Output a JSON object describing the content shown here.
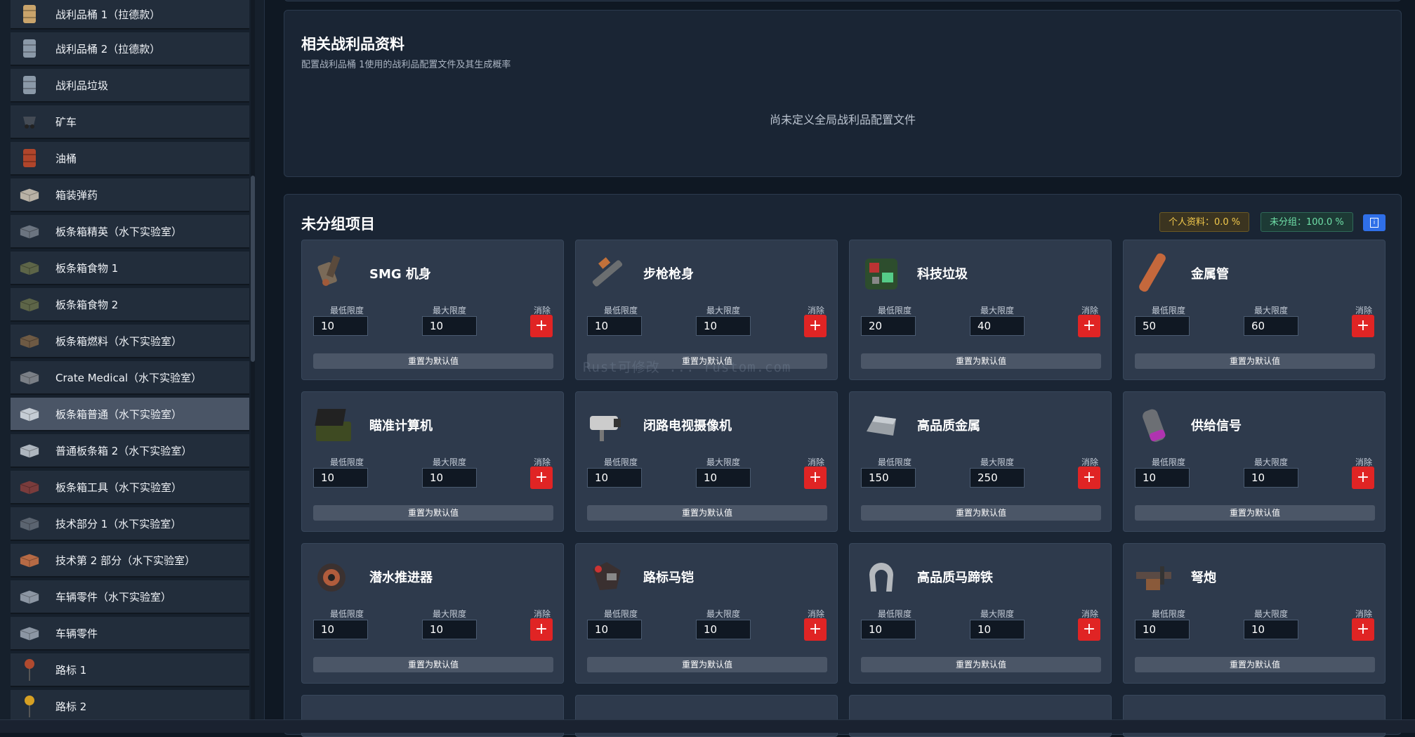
{
  "sidebar": {
    "items": [
      {
        "label": "战利品桶 1（拉德款）",
        "icon": "barrel-icon",
        "color": "#c9a46b"
      },
      {
        "label": "战利品桶 2（拉德款）",
        "icon": "barrel-icon",
        "color": "#8b99a8"
      },
      {
        "label": "战利品垃圾",
        "icon": "trash-barrel-icon",
        "color": "#8b99a8"
      },
      {
        "label": "矿车",
        "icon": "minecart-icon",
        "color": "#444b55"
      },
      {
        "label": "油桶",
        "icon": "oil-barrel-icon",
        "color": "#b0452b"
      },
      {
        "label": "箱装弹药",
        "icon": "ammo-crate-icon",
        "color": "#b9b2a6"
      },
      {
        "label": "板条箱精英（水下实验室）",
        "icon": "crate-icon",
        "color": "#6b7480"
      },
      {
        "label": "板条箱食物 1",
        "icon": "food-crate-icon",
        "color": "#5d6548"
      },
      {
        "label": "板条箱食物 2",
        "icon": "food-crate-icon",
        "color": "#5d6548"
      },
      {
        "label": "板条箱燃料（水下实验室）",
        "icon": "fuel-crate-icon",
        "color": "#6e5a44"
      },
      {
        "label": "Crate Medical（水下实验室）",
        "icon": "medical-crate-icon",
        "color": "#7a7f86"
      },
      {
        "label": "板条箱普通（水下实验室）",
        "icon": "crate-icon",
        "color": "#c5ccd4",
        "active": true
      },
      {
        "label": "普通板条箱 2（水下实验室）",
        "icon": "crate-icon",
        "color": "#aeb6bf"
      },
      {
        "label": "板条箱工具（水下实验室）",
        "icon": "tool-crate-icon",
        "color": "#7a3c3c"
      },
      {
        "label": "技术部分 1（水下实验室）",
        "icon": "tech-crate-icon",
        "color": "#5b6470"
      },
      {
        "label": "技术第 2 部分（水下实验室）",
        "icon": "tech-crate-icon",
        "color": "#b66a45"
      },
      {
        "label": "车辆零件（水下实验室）",
        "icon": "vehicle-parts-icon",
        "color": "#8c96a3"
      },
      {
        "label": "车辆零件",
        "icon": "vehicle-parts-icon",
        "color": "#8c96a3"
      },
      {
        "label": "路标 1",
        "icon": "roadsign-icon",
        "color": "#b04a2f"
      },
      {
        "label": "路标 2",
        "icon": "roadsign-icon",
        "color": "#d6a023"
      }
    ]
  },
  "loot_panel": {
    "title": "相关战利品资料",
    "subtitle": "配置战利品桶 1使用的战利品配置文件及其生成概率",
    "empty_message": "尚未定义全局战利品配置文件"
  },
  "ungrouped": {
    "title": "未分组项目",
    "personal_badge": "个人资料：0.0 %",
    "ungrouped_badge": "未分组：100.0 %",
    "info_label": "i",
    "labels": {
      "min": "最低限度",
      "max": "最大限度",
      "remove": "消除",
      "reset": "重置为默认值",
      "remove_glyph": "+"
    },
    "items": [
      {
        "name": "SMG 机身",
        "min": "10",
        "max": "10",
        "icon": "smg-body-icon"
      },
      {
        "name": "步枪枪身",
        "min": "10",
        "max": "10",
        "icon": "rifle-body-icon"
      },
      {
        "name": "科技垃圾",
        "min": "20",
        "max": "40",
        "icon": "tech-trash-icon"
      },
      {
        "name": "金属管",
        "min": "50",
        "max": "60",
        "icon": "metal-pipe-icon"
      },
      {
        "name": "瞄准计算机",
        "min": "10",
        "max": "10",
        "icon": "targeting-computer-icon"
      },
      {
        "name": "闭路电视摄像机",
        "min": "10",
        "max": "10",
        "icon": "cctv-camera-icon"
      },
      {
        "name": "高品质金属",
        "min": "150",
        "max": "250",
        "icon": "hq-metal-icon"
      },
      {
        "name": "供给信号",
        "min": "10",
        "max": "10",
        "icon": "supply-signal-icon"
      },
      {
        "name": "潜水推进器",
        "min": "10",
        "max": "10",
        "icon": "diving-propeller-icon"
      },
      {
        "name": "路标马铠",
        "min": "10",
        "max": "10",
        "icon": "roadsign-horse-armor-icon"
      },
      {
        "name": "高品质马蹄铁",
        "min": "10",
        "max": "10",
        "icon": "horseshoe-icon"
      },
      {
        "name": "弩炮",
        "min": "10",
        "max": "10",
        "icon": "ballista-icon"
      }
    ]
  },
  "watermark": "Rust可修改 ... rustom.com"
}
